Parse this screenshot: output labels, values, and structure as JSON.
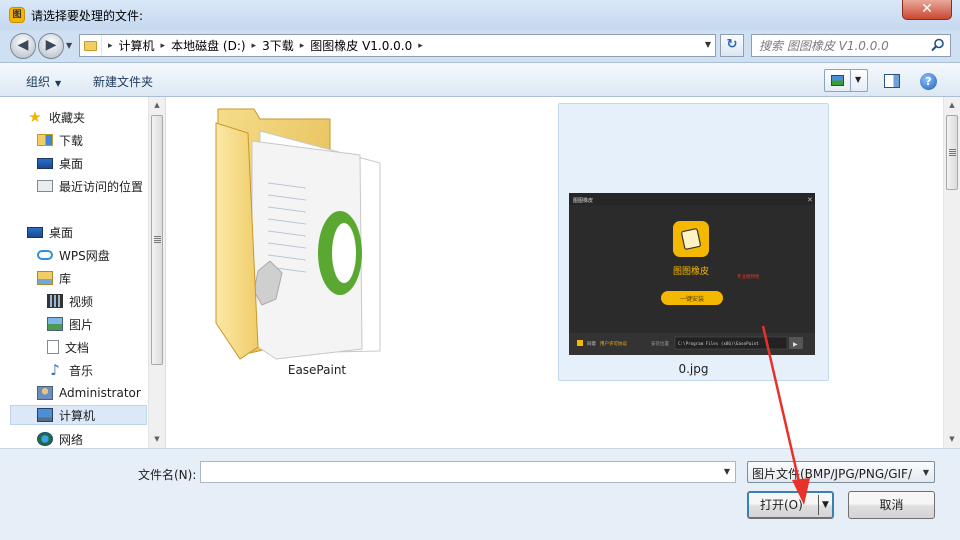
{
  "window": {
    "title": "请选择要处理的文件:",
    "app_icon_glyph": "图",
    "close_glyph": "✕"
  },
  "address": {
    "breadcrumbs": [
      "计算机",
      "本地磁盘 (D:)",
      "3下载",
      "图图橡皮 V1.0.0.0"
    ],
    "separator": "▸",
    "dropdown_glyph": "▼",
    "refresh_glyph": "↻",
    "back_glyph": "◀",
    "forward_glyph": "▶",
    "recent_glyph": "▼"
  },
  "search": {
    "placeholder": "搜索 图图橡皮 V1.0.0.0"
  },
  "toolbar": {
    "organize": "组织",
    "new_folder": "新建文件夹",
    "caret": "▼",
    "help_glyph": "?"
  },
  "nav": {
    "items": [
      {
        "label": "收藏夹",
        "icon": "star-icon"
      },
      {
        "label": "下载",
        "icon": "downloads-folder-icon"
      },
      {
        "label": "桌面",
        "icon": "desktop-icon"
      },
      {
        "label": "最近访问的位置",
        "icon": "recent-places-icon"
      },
      {
        "label": "桌面",
        "icon": "desktop-icon"
      },
      {
        "label": "WPS网盘",
        "icon": "cloud-icon"
      },
      {
        "label": "库",
        "icon": "library-icon"
      },
      {
        "label": "视频",
        "icon": "video-library-icon"
      },
      {
        "label": "图片",
        "icon": "pictures-library-icon"
      },
      {
        "label": "文档",
        "icon": "documents-library-icon"
      },
      {
        "label": "音乐",
        "icon": "music-library-icon"
      },
      {
        "label": "Administrator",
        "icon": "user-folder-icon"
      },
      {
        "label": "计算机",
        "icon": "computer-icon"
      },
      {
        "label": "网络",
        "icon": "network-icon"
      }
    ],
    "selected": "计算机"
  },
  "files": [
    {
      "name": "EasePaint",
      "kind": "folder"
    },
    {
      "name": "0.jpg",
      "kind": "image",
      "selected": true
    }
  ],
  "thumbnail": {
    "window_title": "图图橡皮",
    "app_name": "图图橡皮",
    "version_note": "专业版特性",
    "install_button": "一键安装",
    "agree_prefix": "同意",
    "agree_link": "用户许可协议",
    "path_label": "安装位置",
    "path_value": "C:\\Program Files (x86)\\EasePaint",
    "close_glyph": "✕",
    "next_glyph": "▶"
  },
  "bottom": {
    "filename_label": "文件名(N):",
    "filename_value": "",
    "file_type": "图片文件(BMP/JPG/PNG/GIF/",
    "open_button": "打开(O)",
    "cancel_button": "取消",
    "caret": "▼"
  },
  "scrollbar": {
    "up_glyph": "▲",
    "down_glyph": "▼"
  },
  "colors": {
    "annotation_arrow": "#e8312a",
    "thumbnail_bg": "#2b2b2b",
    "thumbnail_accent": "#f5b800"
  }
}
